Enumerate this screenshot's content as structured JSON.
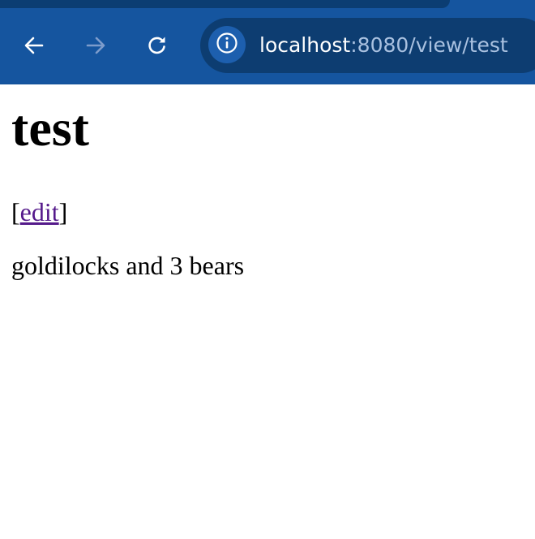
{
  "browser": {
    "url_host": "localhost",
    "url_path": ":8080/view/test",
    "colors": {
      "toolbar": "#15559f",
      "omnibox": "#0d3d71",
      "link_visited": "#551a8b"
    },
    "icons": {
      "back": "arrow-left-icon",
      "forward": "arrow-right-icon",
      "reload": "reload-icon",
      "site_info": "info-icon"
    }
  },
  "page": {
    "title": "test",
    "edit_open_bracket": "[",
    "edit_link": "edit",
    "edit_close_bracket": "]",
    "body": "goldilocks and 3 bears"
  }
}
